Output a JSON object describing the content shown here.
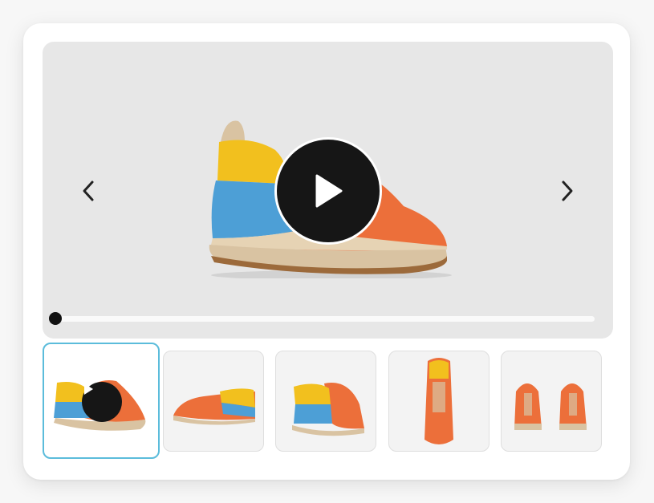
{
  "player": {
    "progress": 0,
    "active_index": 0
  },
  "colors": {
    "accent": "#5bbcdb",
    "stage_bg": "#e7e7e7",
    "shoe_orange": "#ec6f3a",
    "shoe_yellow": "#f2c01e",
    "shoe_blue": "#4d9fd6",
    "sole_beige": "#d9c3a2"
  },
  "icons": {
    "prev": "chevron-left-icon",
    "next": "chevron-right-icon",
    "play": "play-icon"
  },
  "thumbnails": [
    {
      "view": "video",
      "has_play_icon": true
    },
    {
      "view": "side"
    },
    {
      "view": "back-three-quarter"
    },
    {
      "view": "top"
    },
    {
      "view": "front-pair"
    }
  ]
}
